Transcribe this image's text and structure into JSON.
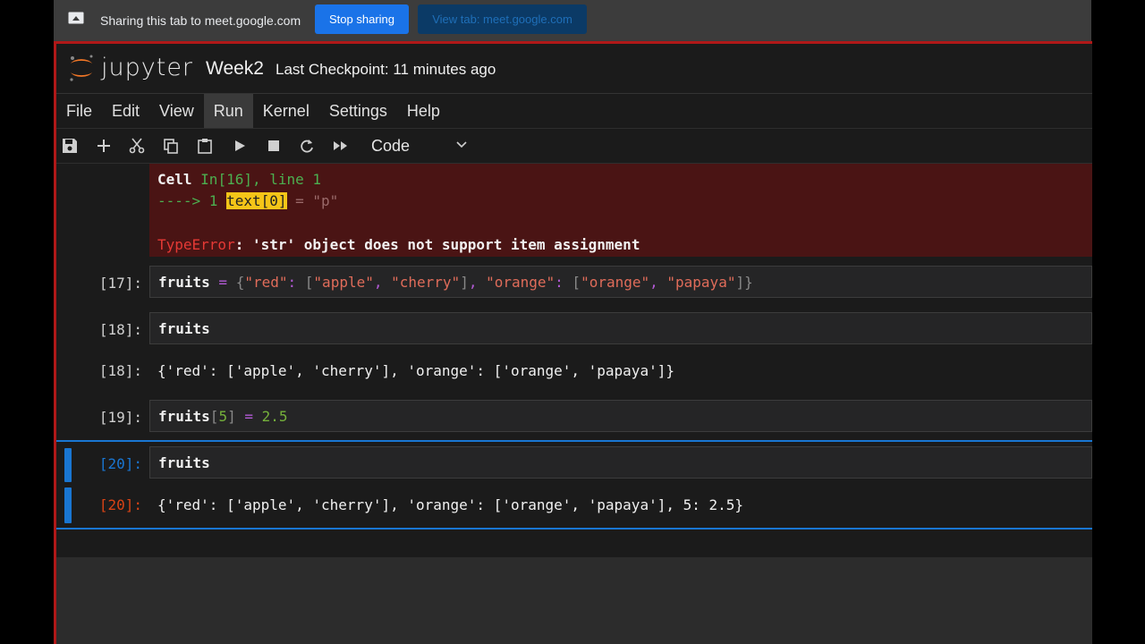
{
  "sharebar": {
    "sharing_text": "Sharing this tab to meet.google.com",
    "stop_label": "Stop sharing",
    "view_tab_label": "View tab: meet.google.com"
  },
  "header": {
    "brand": "jupyter",
    "notebook_title": "Week2",
    "checkpoint": "Last Checkpoint: 11 minutes ago"
  },
  "menu": [
    "File",
    "Edit",
    "View",
    "Run",
    "Kernel",
    "Settings",
    "Help"
  ],
  "toolbar": {
    "icons": [
      "save-icon",
      "add-icon",
      "cut-icon",
      "copy-icon",
      "paste-icon",
      "run-icon",
      "stop-icon",
      "restart-icon",
      "run-all-icon"
    ],
    "cell_type": "Code"
  },
  "error": {
    "line1_prefix": "Cell ",
    "line1_ref": "In[16], line 1",
    "line2_arrow": "----> 1 ",
    "line2_code": "text[0]",
    "line2_rest": " = \"p\"",
    "line3_type": "TypeError",
    "line3_msg": ": 'str' object does not support item assignment"
  },
  "cells": {
    "c17": {
      "prompt": "[17]:"
    },
    "c18": {
      "prompt": "[18]:",
      "out_prompt": "[18]:",
      "output": "{'red': ['apple', 'cherry'], 'orange': ['orange', 'papaya']}"
    },
    "c19": {
      "prompt": "[19]:"
    },
    "c20": {
      "prompt": "[20]:",
      "out_prompt": "[20]:",
      "output": "{'red': ['apple', 'cherry'], 'orange': ['orange', 'papaya'], 5: 2.5}"
    }
  },
  "code": {
    "c17": {
      "var": "fruits",
      "eq": " = ",
      "b1": "{",
      "k1": "\"red\"",
      "colon1": ": ",
      "lb1": "[",
      "s1": "\"apple\"",
      "comma1": ", ",
      "s2": "\"cherry\"",
      "rb1": "]",
      "comma2": ", ",
      "k2": "\"orange\"",
      "colon2": ": ",
      "lb2": "[",
      "s3": "\"orange\"",
      "comma3": ", ",
      "s4": "\"papaya\"",
      "rb2": "]",
      "b2": "}"
    },
    "c18": {
      "var": "fruits"
    },
    "c19": {
      "var": "fruits",
      "idx_open": "[",
      "idx": "5",
      "idx_close": "]",
      "eq": " = ",
      "val": "2.5"
    },
    "c20": {
      "var": "fruits"
    }
  },
  "colors": {
    "accent": "#1976d2",
    "error_bg": "#4a1414",
    "share_blue": "#1a73e8"
  }
}
